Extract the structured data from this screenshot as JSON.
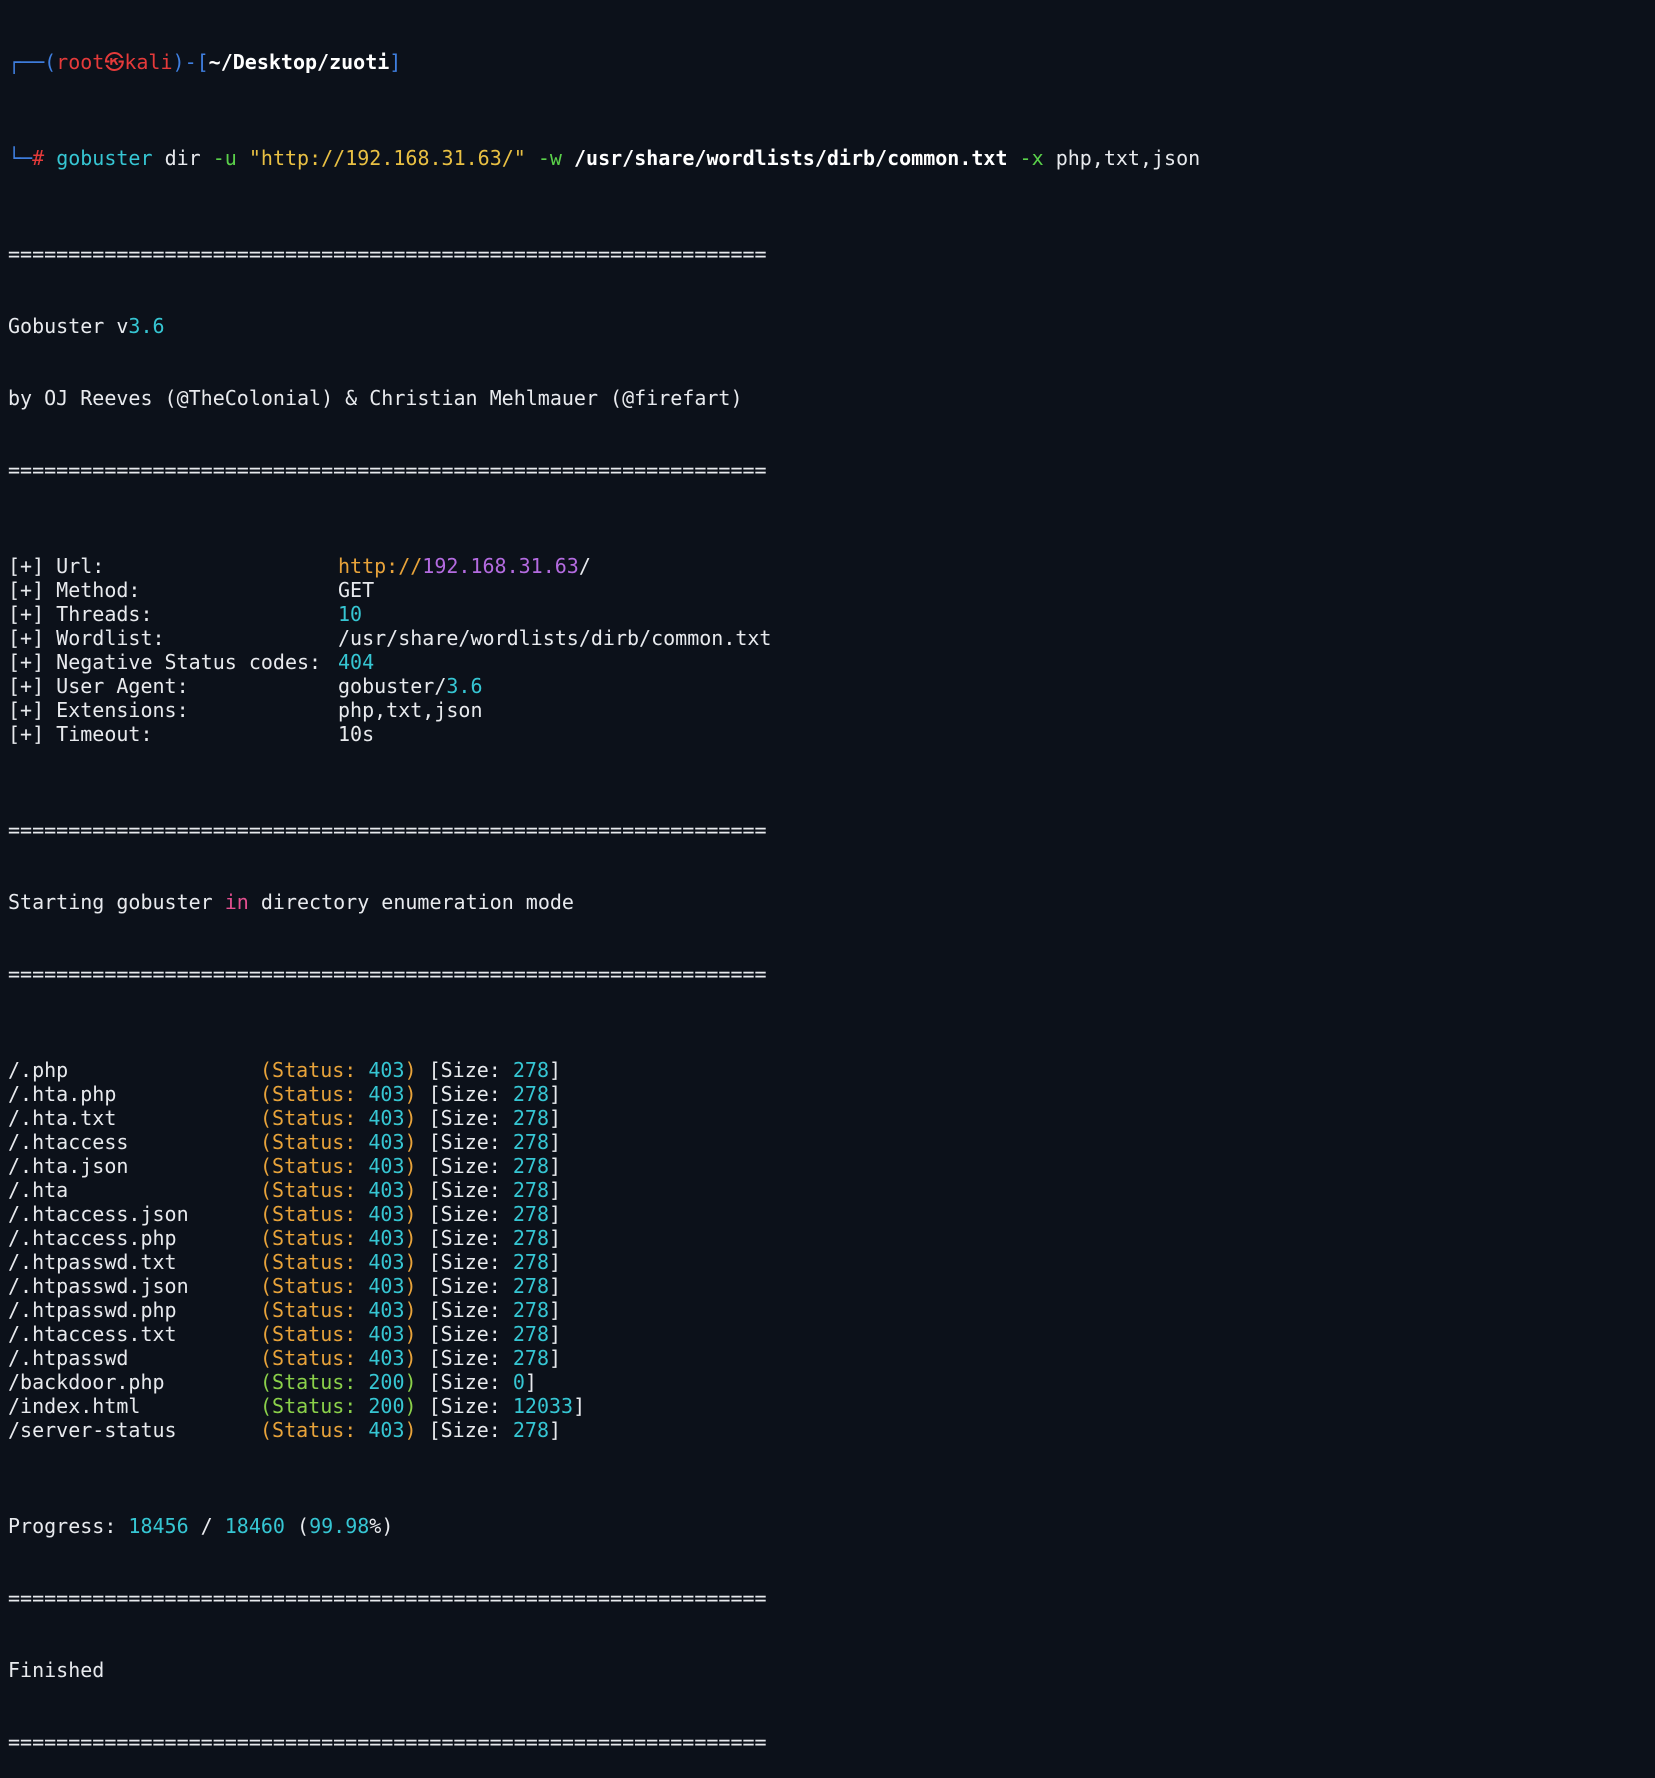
{
  "prompt": {
    "corner_top": "┌──",
    "open_paren": "(",
    "user": "root",
    "at": "㉿",
    "host": "kali",
    "close_paren": ")",
    "dash": "-",
    "open_bracket": "[",
    "cwd": "~/Desktop/zuoti",
    "close_bracket": "]",
    "corner_bottom": "└─",
    "hash": "#"
  },
  "command": {
    "bin": "gobuster",
    "sub": "dir",
    "flag_u": "-u",
    "url": "\"http://192.168.31.63/\"",
    "flag_w": "-w",
    "wordlist": "/usr/share/wordlists/dirb/common.txt",
    "flag_x": "-x",
    "exts": "php,txt,json"
  },
  "separator": "===============================================================",
  "banner": {
    "name": "Gobuster v",
    "version": "3.6",
    "authors": "by OJ Reeves (@TheColonial) & Christian Mehlmauer (@firefart)"
  },
  "config": [
    {
      "label": "[+] Url:",
      "value_a": "http://",
      "value_b": "192.168.31.63",
      "value_c": "/"
    },
    {
      "label": "[+] Method:",
      "value_a": "",
      "value_b": "",
      "value_c": "GET"
    },
    {
      "label": "[+] Threads:",
      "value_a": "",
      "value_b": "10",
      "value_c": ""
    },
    {
      "label": "[+] Wordlist:",
      "value_a": "",
      "value_b": "",
      "value_c": "/usr/share/wordlists/dirb/common.txt"
    },
    {
      "label": "[+] Negative Status codes:",
      "value_a": "",
      "value_b": "404",
      "value_c": ""
    },
    {
      "label": "[+] User Agent:",
      "value_a": "gobuster/",
      "value_b": "3.6",
      "value_c": ""
    },
    {
      "label": "[+] Extensions:",
      "value_a": "php,txt,json",
      "value_b": "",
      "value_c": ""
    },
    {
      "label": "[+] Timeout:",
      "value_a": "10s",
      "value_b": "",
      "value_c": ""
    }
  ],
  "starting": {
    "pre": "Starting gobuster ",
    "kw": "in",
    "post": " directory enumeration mode"
  },
  "results": [
    {
      "path": "/.php",
      "status": "403",
      "size": "278"
    },
    {
      "path": "/.hta.php",
      "status": "403",
      "size": "278"
    },
    {
      "path": "/.hta.txt",
      "status": "403",
      "size": "278"
    },
    {
      "path": "/.htaccess",
      "status": "403",
      "size": "278"
    },
    {
      "path": "/.hta.json",
      "status": "403",
      "size": "278"
    },
    {
      "path": "/.hta",
      "status": "403",
      "size": "278"
    },
    {
      "path": "/.htaccess.json",
      "status": "403",
      "size": "278"
    },
    {
      "path": "/.htaccess.php",
      "status": "403",
      "size": "278"
    },
    {
      "path": "/.htpasswd.txt",
      "status": "403",
      "size": "278"
    },
    {
      "path": "/.htpasswd.json",
      "status": "403",
      "size": "278"
    },
    {
      "path": "/.htpasswd.php",
      "status": "403",
      "size": "278"
    },
    {
      "path": "/.htaccess.txt",
      "status": "403",
      "size": "278"
    },
    {
      "path": "/.htpasswd",
      "status": "403",
      "size": "278"
    },
    {
      "path": "/backdoor.php",
      "status": "200",
      "size": "0"
    },
    {
      "path": "/index.html",
      "status": "200",
      "size": "12033"
    },
    {
      "path": "/server-status",
      "status": "403",
      "size": "278"
    }
  ],
  "result_labels": {
    "status_open": "(Status: ",
    "status_close": ")",
    "size_open": " [Size: ",
    "size_close": "]"
  },
  "progress": {
    "label": "Progress: ",
    "done": "18456",
    "slash": " / ",
    "total": "18460",
    "pct_open": " (",
    "pct": "99.98",
    "pct_close": "%)"
  },
  "finished": "Finished",
  "colors": {
    "background": "#0c111a",
    "status_403": "#e8a33a",
    "status_200": "#8bd14a",
    "number": "#36c6d3"
  }
}
